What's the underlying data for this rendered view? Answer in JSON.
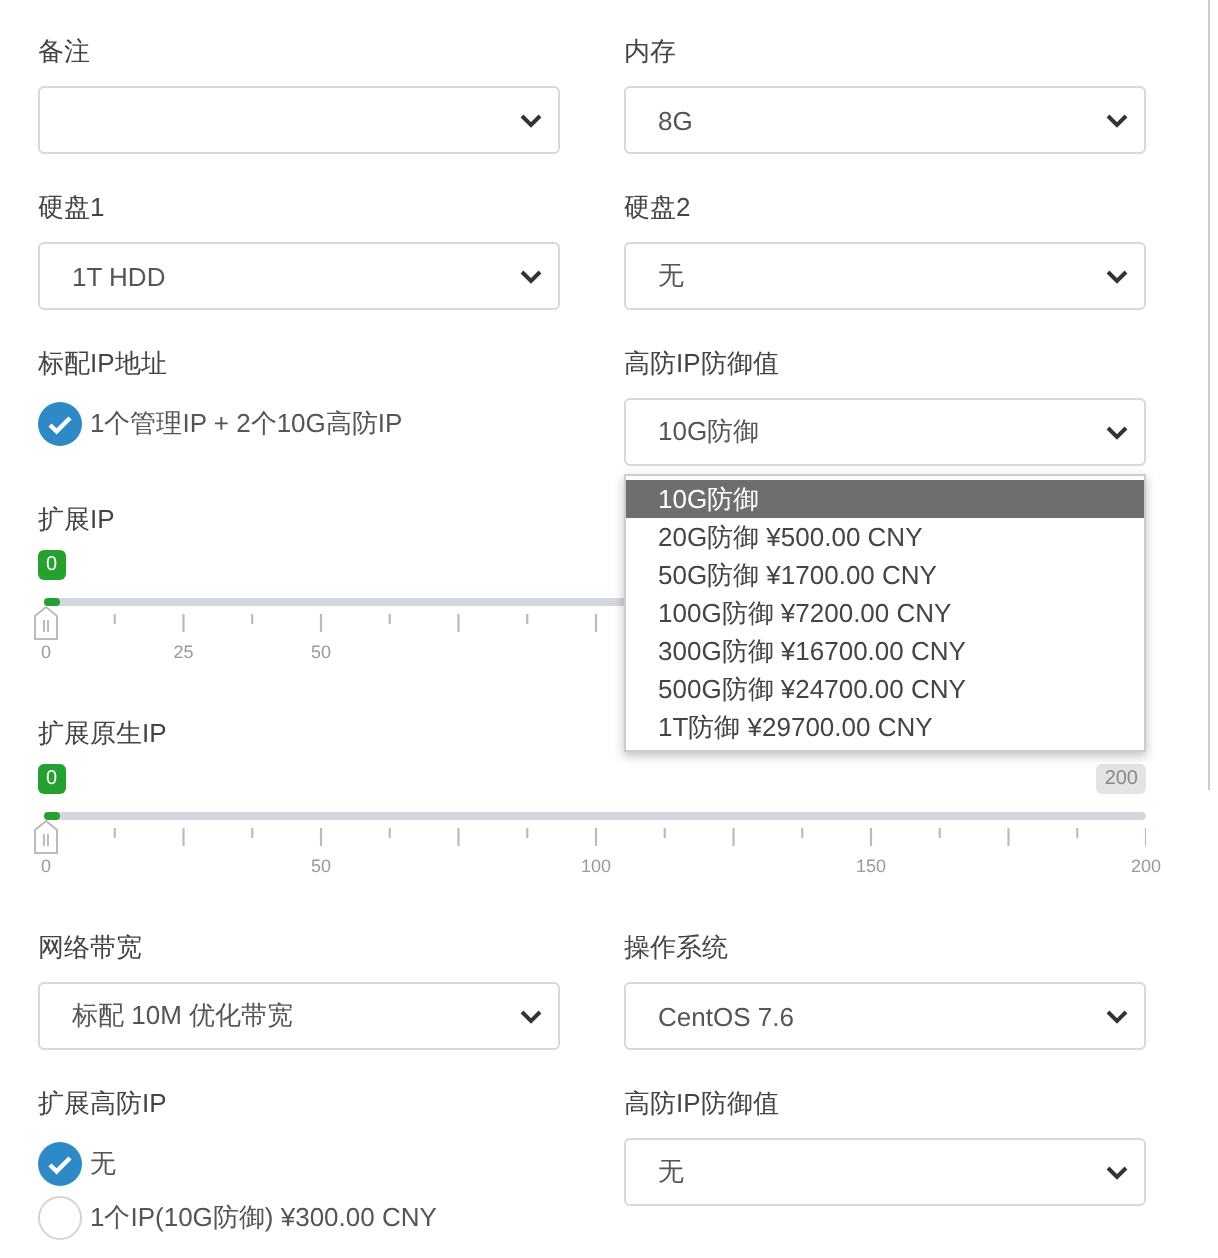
{
  "rows": [
    {
      "kind": "pair",
      "cells": [
        {
          "kind": "select",
          "label": "备注"
        },
        {
          "kind": "select",
          "label": "内存",
          "value": "8G"
        }
      ]
    },
    {
      "kind": "pair",
      "cells": [
        {
          "kind": "select",
          "label": "硬盘1",
          "value": "1T HDD"
        },
        {
          "kind": "select",
          "label": "硬盘2",
          "value": "无"
        }
      ]
    },
    {
      "kind": "pair",
      "cells": [
        {
          "kind": "choice",
          "label": "标配IP地址",
          "options": [
            {
              "text": "1个管理IP + 2个10G高防IP",
              "selected": true
            }
          ]
        },
        {
          "kind": "select",
          "label": "高防IP防御值",
          "value": "10G防御",
          "open": true,
          "options": [
            {
              "text": "10G防御",
              "selected": true
            },
            {
              "text": "20G防御 ¥500.00 CNY",
              "selected": false
            },
            {
              "text": "50G防御 ¥1700.00 CNY",
              "selected": false
            },
            {
              "text": "100G防御 ¥7200.00 CNY",
              "selected": false
            },
            {
              "text": "300G防御 ¥16700.00 CNY",
              "selected": false
            },
            {
              "text": "500G防御 ¥24700.00 CNY",
              "selected": false
            },
            {
              "text": "1T防御 ¥29700.00 CNY",
              "selected": false
            }
          ]
        }
      ]
    },
    {
      "kind": "slider",
      "label": "扩展IP",
      "value": "0",
      "level": 0,
      "tick_labels": [
        "0",
        "25",
        "50"
      ]
    },
    {
      "kind": "slider",
      "label": "扩展原生IP",
      "value": "0",
      "level": 0,
      "max_badge": "200",
      "tick_labels": [
        "0",
        "50",
        "100",
        "150",
        "200"
      ]
    },
    {
      "kind": "pair",
      "cells": [
        {
          "kind": "select",
          "label": "网络带宽",
          "value": "标配 10M 优化带宽"
        },
        {
          "kind": "select",
          "label": "操作系统",
          "value": "CentOS 7.6"
        }
      ]
    },
    {
      "kind": "pair",
      "cells": [
        {
          "kind": "choice",
          "label": "扩展高防IP",
          "options": [
            {
              "text": "无",
              "selected": true
            },
            {
              "text": "1个IP(10G防御) ¥300.00 CNY",
              "selected": false
            }
          ]
        },
        {
          "kind": "select",
          "label": "高防IP防御值",
          "value": "无"
        }
      ]
    }
  ]
}
